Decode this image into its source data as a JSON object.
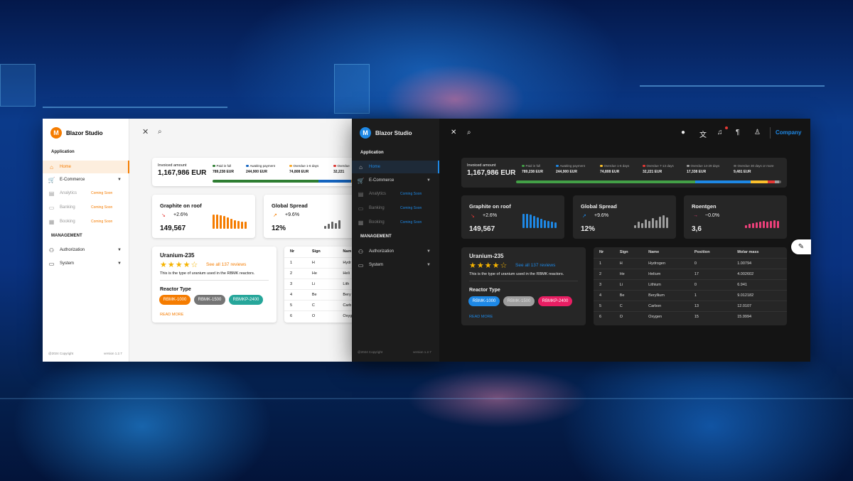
{
  "light": {
    "brand": "Blazor Studio",
    "logo_letter": "M",
    "accent": "#f57c00",
    "section_application": "Application",
    "nav": [
      {
        "label": "Home",
        "icon": "home-icon"
      },
      {
        "label": "E-Commerce",
        "icon": "cart-icon"
      },
      {
        "label": "Analytics",
        "icon": "chart-icon",
        "badge": "Coming Soon"
      },
      {
        "label": "Banking",
        "icon": "bank-icon",
        "badge": "Coming Soon"
      },
      {
        "label": "Booking",
        "icon": "calendar-icon",
        "badge": "Coming Soon"
      }
    ],
    "section_management": "MANAGEMENT",
    "nav2": [
      {
        "label": "Authorization",
        "icon": "user-key-icon"
      },
      {
        "label": "System",
        "icon": "computer-icon"
      }
    ],
    "footer_copy": "@2024 Copyright",
    "footer_version": "version 1.2.7",
    "invoice": {
      "label": "Invoiced amount",
      "value": "1,167,986 EUR",
      "segments": [
        {
          "label": "Paid in full",
          "value": "789,238 EUR",
          "color": "#2e7d32"
        },
        {
          "label": "Awaiting payment",
          "value": "244,900 EUR",
          "color": "#1565c0"
        },
        {
          "label": "Overdue 1-6 days",
          "value": "74,808 EUR",
          "color": "#f9a825"
        },
        {
          "label": "Overdue",
          "value": "32,221",
          "color": "#e53935"
        }
      ],
      "progress": [
        0.676,
        0.21,
        0.064,
        0.05
      ]
    },
    "kpi": [
      {
        "title": "Graphite on roof",
        "change": "+2.6%",
        "value": "149,567",
        "color": "#f57c00",
        "spark": [
          1.0,
          1.0,
          0.95,
          0.9,
          0.8,
          0.7,
          0.6,
          0.55,
          0.5,
          0.5
        ]
      },
      {
        "title": "Global Spread",
        "change": "+9.6%",
        "value": "12%",
        "color": "#666666",
        "spark": [
          0.2,
          0.35,
          0.5,
          0.4,
          0.6
        ]
      }
    ],
    "product": {
      "title": "Uranium-235",
      "stars": "★★★★☆",
      "reviews": "See all 137 reviews",
      "desc": "This is the type of uranium used in the RBMK reactors.",
      "reactor_title": "Reactor Type",
      "chips": [
        {
          "label": "RBMK-1000",
          "color": "#f57c00"
        },
        {
          "label": "RBMK-1500",
          "color": "#757575"
        },
        {
          "label": "RBMKP-2400",
          "color": "#26a69a"
        }
      ],
      "read_more": "READ MORE"
    },
    "table": {
      "headers": [
        "Nr",
        "Sign",
        "Nam"
      ],
      "rows": [
        [
          "1",
          "H",
          "Hydr"
        ],
        [
          "2",
          "He",
          "Heli"
        ],
        [
          "3",
          "Li",
          "Lith"
        ],
        [
          "4",
          "Be",
          "Bery"
        ],
        [
          "5",
          "C",
          "Carb"
        ],
        [
          "6",
          "O",
          "Oxyg"
        ]
      ]
    }
  },
  "dark": {
    "brand": "Blazor Studio",
    "logo_letter": "M",
    "accent": "#1e88e5",
    "company": "Company",
    "section_application": "Application",
    "nav": [
      {
        "label": "Home",
        "icon": "home-icon"
      },
      {
        "label": "E-Commerce",
        "icon": "cart-icon"
      },
      {
        "label": "Analytics",
        "icon": "chart-icon",
        "badge": "Coming Soon"
      },
      {
        "label": "Banking",
        "icon": "bank-icon",
        "badge": "Coming Soon"
      },
      {
        "label": "Booking",
        "icon": "calendar-icon",
        "badge": "Coming Soon"
      }
    ],
    "section_management": "MANAGEMENT",
    "nav2": [
      {
        "label": "Authorization",
        "icon": "user-key-icon"
      },
      {
        "label": "System",
        "icon": "computer-icon"
      }
    ],
    "footer_copy": "@2024 Copyright",
    "footer_version": "version 1.2.7",
    "invoice": {
      "label": "Invoiced amount",
      "value": "1,167,986 EUR",
      "segments": [
        {
          "label": "Paid in full",
          "value": "789,238 EUR",
          "color": "#43a047"
        },
        {
          "label": "Awaiting payment",
          "value": "244,900 EUR",
          "color": "#1e88e5"
        },
        {
          "label": "Overdue 1-6 days",
          "value": "74,808 EUR",
          "color": "#fbc02d"
        },
        {
          "label": "Overdue 7-13 days",
          "value": "32,221 EUR",
          "color": "#e53935"
        },
        {
          "label": "Overdue 14-29 days",
          "value": "17,338 EUR",
          "color": "#9e9e9e"
        },
        {
          "label": "Overdue 30 days or more",
          "value": "9,481 EUR",
          "color": "#616161"
        }
      ],
      "progress": [
        0.676,
        0.21,
        0.064,
        0.028,
        0.015,
        0.008
      ]
    },
    "kpi": [
      {
        "title": "Graphite on roof",
        "change": "+2.6%",
        "value": "149,567",
        "color": "#1e88e5",
        "spark": [
          1.0,
          1.0,
          0.95,
          0.85,
          0.75,
          0.65,
          0.55,
          0.5,
          0.45,
          0.4
        ]
      },
      {
        "title": "Global Spread",
        "change": "+9.6%",
        "value": "12%",
        "color": "#9e9e9e",
        "spark": [
          0.2,
          0.45,
          0.35,
          0.6,
          0.5,
          0.7,
          0.55,
          0.8,
          0.9,
          0.75
        ]
      },
      {
        "title": "Roentgen",
        "change": "~0.0%",
        "value": "3,6",
        "color": "#ec407a",
        "spark": [
          0.2,
          0.3,
          0.35,
          0.4,
          0.45,
          0.5,
          0.45,
          0.5,
          0.55,
          0.5
        ]
      }
    ],
    "product": {
      "title": "Uranium-235",
      "stars": "★★★★☆",
      "reviews": "See all 137 reviews",
      "desc": "This is the type of uranium used in the RBMK reactors.",
      "reactor_title": "Reactor Type",
      "chips": [
        {
          "label": "RBMK-1000",
          "color": "#1e88e5"
        },
        {
          "label": "RBMK-1500",
          "color": "#9e9e9e"
        },
        {
          "label": "RBMKP-2400",
          "color": "#e91e63"
        }
      ],
      "read_more": "READ MORE"
    },
    "table": {
      "headers": [
        "Nr",
        "Sign",
        "Name",
        "Position",
        "Molar mass"
      ],
      "rows": [
        [
          "1",
          "H",
          "Hydrogen",
          "0",
          "1.00794"
        ],
        [
          "2",
          "He",
          "Helium",
          "17",
          "4.002602"
        ],
        [
          "3",
          "Li",
          "Lithium",
          "0",
          "6.941"
        ],
        [
          "4",
          "Be",
          "Beryllium",
          "1",
          "9.012182"
        ],
        [
          "5",
          "C",
          "Carbon",
          "13",
          "12.0107"
        ],
        [
          "6",
          "O",
          "Oxygen",
          "15",
          "15.9994"
        ]
      ]
    }
  }
}
